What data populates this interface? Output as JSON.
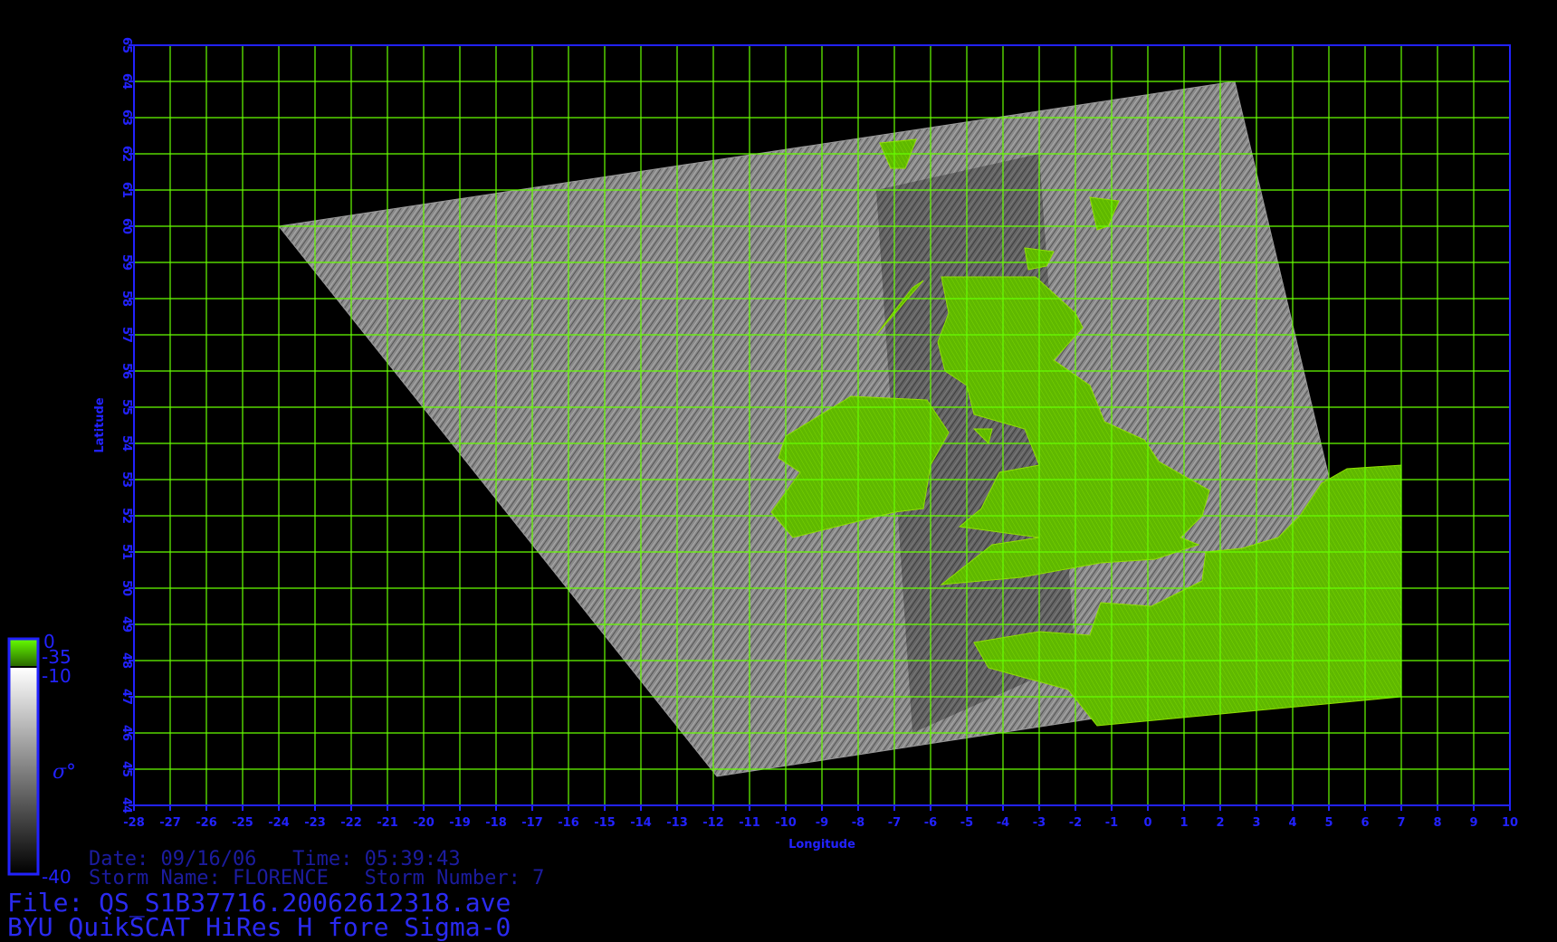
{
  "map": {
    "xlabel": "Longitude",
    "ylabel": "Latitude",
    "lon_range": [
      -28,
      10
    ],
    "lat_range": [
      44,
      65
    ],
    "lon_ticks": [
      -28,
      -27,
      -26,
      -25,
      -24,
      -23,
      -22,
      -21,
      -20,
      -19,
      -18,
      -17,
      -16,
      -15,
      -14,
      -13,
      -12,
      -11,
      -10,
      -9,
      -8,
      -7,
      -6,
      -5,
      -4,
      -3,
      -2,
      -1,
      0,
      1,
      2,
      3,
      4,
      5,
      6,
      7,
      8,
      9,
      10
    ],
    "lat_ticks": [
      44,
      45,
      46,
      47,
      48,
      49,
      50,
      51,
      52,
      53,
      54,
      55,
      56,
      57,
      58,
      59,
      60,
      61,
      62,
      63,
      64,
      65
    ],
    "grid": true,
    "swath_corners": [
      [
        -24,
        60
      ],
      [
        2.4,
        64
      ],
      [
        6.3,
        47.6
      ],
      [
        -11.9,
        44.8
      ]
    ],
    "colors": {
      "grid": "#66ff00",
      "axis": "#2222ff",
      "land": "#5fb800",
      "background": "#000000"
    }
  },
  "colorbar": {
    "top_label": "0",
    "label_m35": "-35",
    "label_m10": "-10",
    "bottom_label": "-40",
    "symbol": "σ°"
  },
  "info": {
    "date_line": "Date: 09/16/06   Time: 05:39:43",
    "storm_line": "Storm Name: FLORENCE   Storm Number: 7",
    "file_line": "File: QS_S1B37716.20062612318.ave",
    "product_line": "BYU QuikSCAT HiRes H fore Sigma-0"
  }
}
